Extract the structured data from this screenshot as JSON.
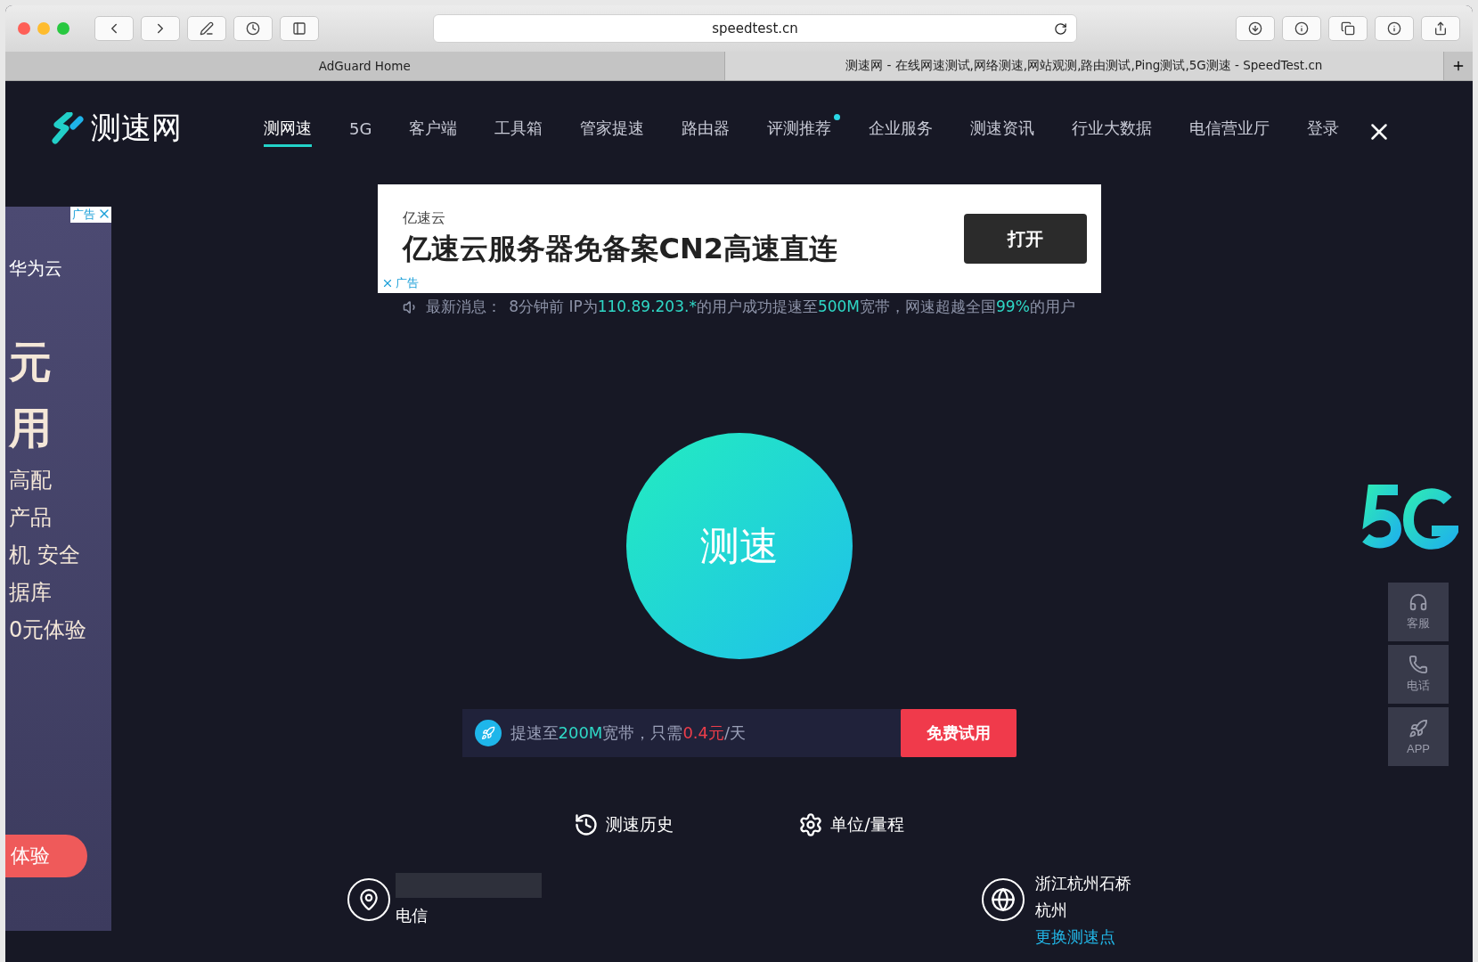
{
  "browser": {
    "url": "speedtest.cn",
    "tabs": [
      {
        "label": "AdGuard Home",
        "selected": false
      },
      {
        "label": "测速网 - 在线网速测试,网络测速,网站观测,路由测试,Ping测试,5G测速 - SpeedTest.cn",
        "selected": true
      }
    ]
  },
  "header": {
    "logo": "测速网",
    "nav": [
      {
        "label": "测网速",
        "selected": true,
        "dot": false
      },
      {
        "label": "5G",
        "selected": false,
        "dot": false
      },
      {
        "label": "客户端",
        "selected": false,
        "dot": false
      },
      {
        "label": "工具箱",
        "selected": false,
        "dot": false
      },
      {
        "label": "管家提速",
        "selected": false,
        "dot": false
      },
      {
        "label": "路由器",
        "selected": false,
        "dot": false
      },
      {
        "label": "评测推荐",
        "selected": false,
        "dot": true
      },
      {
        "label": "企业服务",
        "selected": false,
        "dot": false
      },
      {
        "label": "测速资讯",
        "selected": false,
        "dot": false
      },
      {
        "label": "行业大数据",
        "selected": false,
        "dot": false
      },
      {
        "label": "电信营业厅",
        "selected": false,
        "dot": false
      },
      {
        "label": "登录",
        "selected": false,
        "dot": false
      }
    ]
  },
  "banner_ad": {
    "brand": "亿速云",
    "headline": "亿速云服务器免备案CN2高速直连",
    "button": "打开",
    "ad_label": "广告"
  },
  "news": {
    "label": "最新消息：",
    "segments": [
      {
        "text": "8分钟前 IP为",
        "highlight": false
      },
      {
        "text": "110.89.203.*",
        "highlight": true
      },
      {
        "text": "的用户成功提速至",
        "highlight": false
      },
      {
        "text": "500M",
        "highlight": true
      },
      {
        "text": "宽带，网速超越全国",
        "highlight": false
      },
      {
        "text": "99%",
        "highlight": true
      },
      {
        "text": "的用户",
        "highlight": false
      }
    ]
  },
  "start_button": "测速",
  "promo": {
    "segments": [
      {
        "text": "提速至",
        "color": "#9aa0b8"
      },
      {
        "text": "200M",
        "color": "#2fd8c6"
      },
      {
        "text": "宽带，只需",
        "color": "#9aa0b8"
      },
      {
        "text": "0.4元",
        "color": "#ee3d4a"
      },
      {
        "text": "/天",
        "color": "#9aa0b8"
      }
    ],
    "button": "免费试用"
  },
  "links": [
    {
      "kind": "history",
      "label": "测速历史"
    },
    {
      "kind": "settings",
      "label": "单位/量程"
    }
  ],
  "client": {
    "isp": "电信"
  },
  "server": {
    "lines": [
      "浙江杭州石桥",
      "杭州"
    ],
    "change": "更换测速点"
  },
  "side_ad": {
    "ad_label": "广告",
    "brand": "华为云",
    "lines": [
      "元",
      "用",
      "高配",
      "产品",
      "机 安全",
      "据库",
      "0元体验"
    ],
    "button": "体验"
  },
  "side_buttons": [
    {
      "kind": "service",
      "label": "客服"
    },
    {
      "kind": "phone",
      "label": "电话"
    },
    {
      "kind": "app",
      "label": "APP"
    }
  ]
}
